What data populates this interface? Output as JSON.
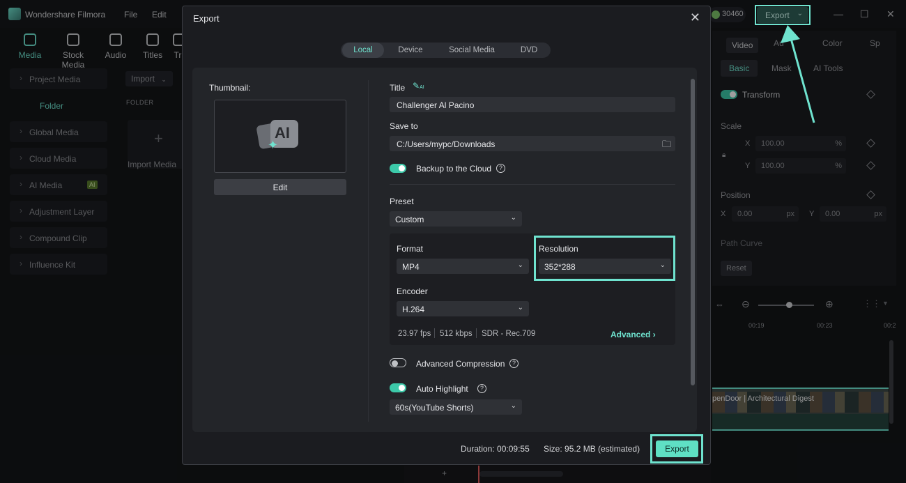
{
  "app": {
    "name": "Wondershare Filmora",
    "menu": [
      "File",
      "Edit"
    ],
    "credits": "30460",
    "top_export_label": "Export",
    "toolbar_tabs": [
      "Media",
      "Stock Media",
      "Audio",
      "Titles",
      "Tr"
    ],
    "sidebar": [
      "Project Media",
      "Folder",
      "Global Media",
      "Cloud Media",
      "AI Media",
      "Adjustment Layer",
      "Compound Clip",
      "Influence Kit"
    ],
    "ai_badge": "AI",
    "import_label": "Import",
    "folder_heading": "FOLDER",
    "import_media_label": "Import Media",
    "right_panel": {
      "tabs": [
        "Video",
        "Au",
        "Color",
        "Sp"
      ],
      "subtabs": [
        "Basic",
        "Mask",
        "AI Tools"
      ],
      "transform_label": "Transform",
      "scale_label": "Scale",
      "scale_x_axis": "X",
      "scale_x": "100.00",
      "scale_x_unit": "%",
      "scale_y_axis": "Y",
      "scale_y": "100.00",
      "scale_y_unit": "%",
      "position_label": "Position",
      "pos_x_axis": "X",
      "pos_x": "0.00",
      "pos_x_unit": "px",
      "pos_y_axis": "Y",
      "pos_y": "0.00",
      "pos_y_unit": "px",
      "path_curve_label": "Path Curve",
      "reset_label": "Reset"
    },
    "timeline": {
      "ruler": [
        "00:19",
        "00:23",
        "00:2"
      ],
      "clip_title": "penDoor | Architectural Digest"
    }
  },
  "dialog": {
    "title": "Export",
    "close_glyph": "✕",
    "tabs": [
      "Local",
      "Device",
      "Social Media",
      "DVD"
    ],
    "thumbnail_label": "Thumbnail:",
    "thumbnail_icon_text": "AI",
    "edit_label": "Edit",
    "title_label": "Title",
    "title_ai_badge": "AI",
    "title_value": "Challenger Al Pacino",
    "save_to_label": "Save to",
    "save_to_value": "C:/Users/mypc/Downloads",
    "backup_label": "Backup to the Cloud",
    "backup_on": true,
    "preset_label": "Preset",
    "preset_value": "Custom",
    "format_label": "Format",
    "format_value": "MP4",
    "resolution_label": "Resolution",
    "resolution_value": "352*288",
    "encoder_label": "Encoder",
    "encoder_value": "H.264",
    "stats": [
      "23.97 fps",
      "512 kbps",
      "SDR - Rec.709"
    ],
    "advanced_label": "Advanced",
    "advanced_compression_label": "Advanced Compression",
    "advanced_compression_on": false,
    "auto_highlight_label": "Auto Highlight",
    "auto_highlight_on": true,
    "highlight_value": "60s(YouTube Shorts)",
    "duration_label": "Duration:",
    "duration_value": "00:09:55",
    "size_label": "Size:",
    "size_value": "95.2 MB (estimated)",
    "export_label": "Export"
  },
  "colors": {
    "accent": "#6fe3cf",
    "export_button": "#5fe0c4",
    "dialog_bg": "#1b1c20"
  }
}
